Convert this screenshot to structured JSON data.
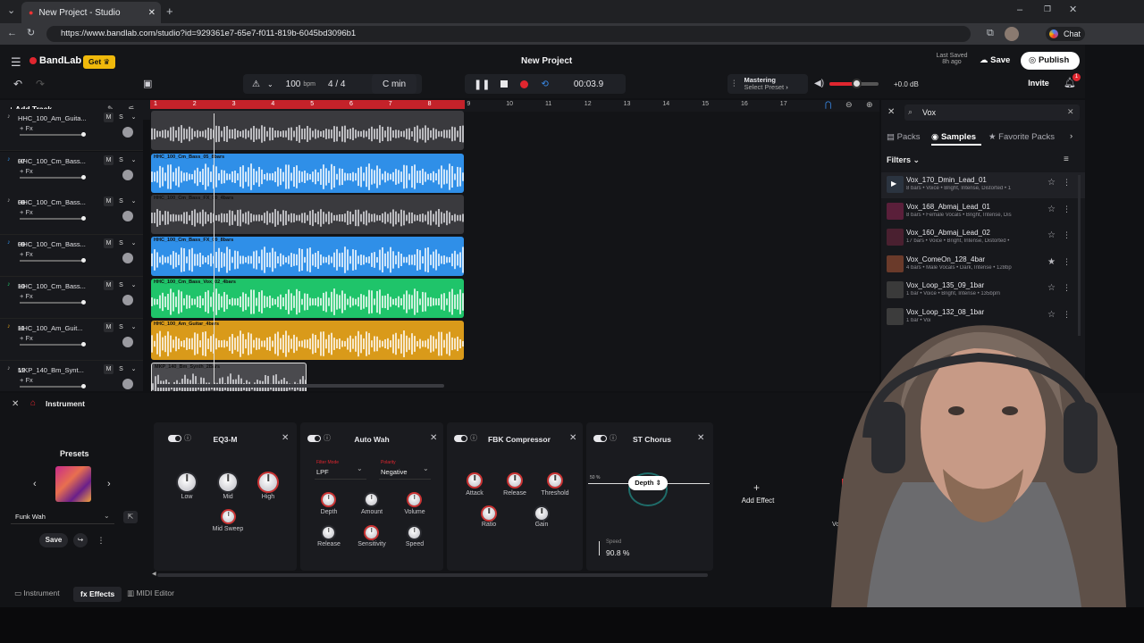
{
  "browser": {
    "tab_title": "New Project - Studio",
    "url": "https://www.bandlab.com/studio?id=929361e7-65e7-f011-819b-6045bd3096b1",
    "chat_label": "Chat"
  },
  "header": {
    "logo": "BandLab",
    "get_label": "Get",
    "project_title": "New Project",
    "last_saved_line1": "Last Saved",
    "last_saved_line2": "8h ago",
    "save_label": "Save",
    "publish_label": "Publish",
    "invite_label": "Invite",
    "notification_count": "1",
    "tempo": "100",
    "tempo_unit": "bpm",
    "time_sig": "4 / 4",
    "key": "C min",
    "time": "00:03.9",
    "mastering_title": "Mastering",
    "mastering_sub": "Select Preset",
    "volume_db": "+0.0 dB",
    "master_volume_level": 0.55
  },
  "toolbar": {
    "add_track_label": "Add Track"
  },
  "ruler": [
    "1",
    "2",
    "3",
    "4",
    "5",
    "6",
    "7",
    "8",
    "9",
    "10",
    "11",
    "12",
    "13",
    "14",
    "15",
    "16",
    "17"
  ],
  "tracks": [
    {
      "num": "",
      "name": "HHC_100_Am_Guita...",
      "fx": "+ Fx",
      "clip": "",
      "color": "#8a8a8e"
    },
    {
      "num": "07",
      "name": "HHC_100_Cm_Bass...",
      "fx": "+ Fx",
      "clip": "HHC_100_Cm_Bass_05_8bars",
      "color": "#2f8fe8"
    },
    {
      "num": "08",
      "name": "HHC_100_Cm_Bass...",
      "fx": "+ Fx",
      "clip": "HHC_100_Cm_Bass_FX_09_4bars",
      "color": "#8a8a8e"
    },
    {
      "num": "09",
      "name": "HHC_100_Cm_Bass...",
      "fx": "+ Fx",
      "clip": "HHC_100_Cm_Bass_FX_09_8bars",
      "color": "#2f8fe8"
    },
    {
      "num": "10",
      "name": "HHC_100_Cm_Bass...",
      "fx": "+ Fx",
      "clip": "HHC_100_Cm_Bass_Vox_02_4bars",
      "color": "#1fc46a"
    },
    {
      "num": "11",
      "name": "HHC_100_Am_Guit...",
      "fx": "+ Fx",
      "clip": "HHC_100_Am_Guitar_4bars",
      "color": "#d99a1a"
    },
    {
      "num": "12",
      "name": "MKP_140_Bm_Synt...",
      "fx": "+ Fx",
      "clip": "MKP_140_Bm_Synth_2Bars",
      "color": "#555559"
    }
  ],
  "browser_panel": {
    "search_value": "Vox",
    "tabs": [
      "Packs",
      "Samples",
      "Favorite Packs"
    ],
    "filters_label": "Filters",
    "samples": [
      {
        "name": "Vox_170_Dmin_Lead_01",
        "meta": "8 bars • Voice • Bright, Intense, Distorted • 1",
        "starred": false
      },
      {
        "name": "Vox_168_Abmaj_Lead_01",
        "meta": "8 bars • Female Vocals • Bright, Intense, Dis",
        "starred": false
      },
      {
        "name": "Vox_160_Abmaj_Lead_02",
        "meta": "17 bars • Voice • Bright, Intense, Distorted •",
        "starred": false
      },
      {
        "name": "Vox_ComeOn_128_4bar",
        "meta": "4 bars • Male Vocals • Dark, Intense • 128bp",
        "starred": true
      },
      {
        "name": "Vox_Loop_135_09_1bar",
        "meta": "1 bar • Voice • Bright, Intense • 135bpm",
        "starred": false
      },
      {
        "name": "Vox_Loop_132_08_1bar",
        "meta": "1 bar • Voi",
        "starred": false
      }
    ]
  },
  "instrument_panel": {
    "header_label": "Instrument",
    "presets_label": "Presets",
    "preset_name": "Funk Wah",
    "save_label": "Save"
  },
  "effects": [
    {
      "title": "EQ3-M",
      "knobs": [
        "Low",
        "Mid",
        "High",
        "Mid Sweep"
      ]
    },
    {
      "title": "Auto Wah",
      "filter_mode_label": "Filter Mode",
      "filter_mode": "LPF",
      "polarity_label": "Polarity",
      "polarity": "Negative",
      "knobs": [
        "Depth",
        "Amount",
        "Volume",
        "Release",
        "Sensitivity",
        "Speed"
      ]
    },
    {
      "title": "FBK Compressor",
      "knobs": [
        "Attack",
        "Release",
        "Threshold",
        "Ratio",
        "Gain"
      ]
    },
    {
      "title": "ST Chorus",
      "depth_label": "Depth",
      "percent_label": "50 %",
      "speed_label": "Speed",
      "speed_value": "90.8 %"
    }
  ],
  "add_effect_label": "Add Effect",
  "volume_label": "Volume",
  "bottom_tabs": [
    "Instrument",
    "Effects",
    "MIDI Editor"
  ],
  "colors": {
    "accent_red": "#e0262f",
    "blue": "#2f8fe8",
    "green": "#1fc46a",
    "gold": "#d99a1a"
  }
}
